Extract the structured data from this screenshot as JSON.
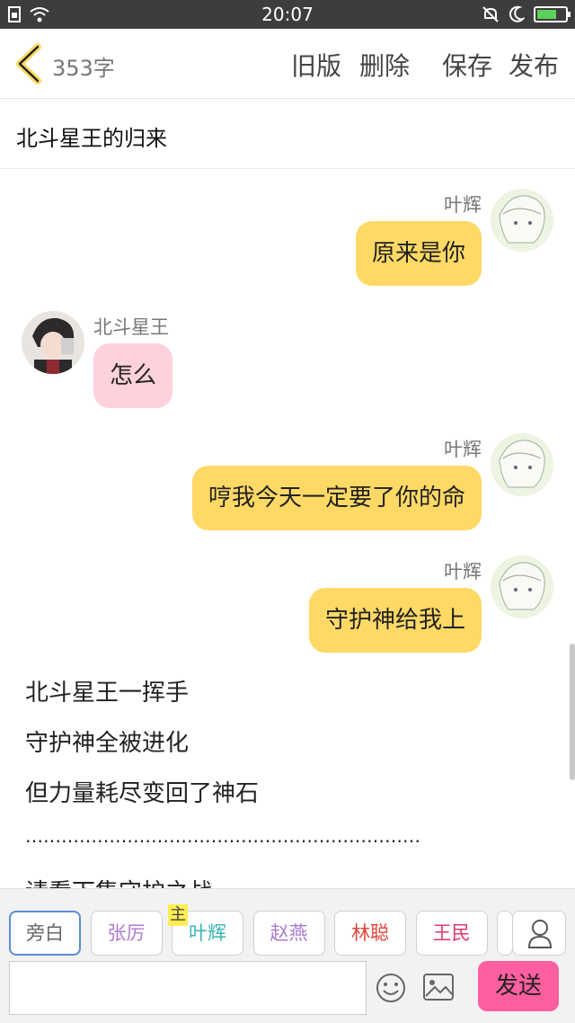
{
  "status_bar": {
    "time": "20:07",
    "battery_level": 0.7
  },
  "topbar": {
    "word_count": "353字",
    "actions": [
      "旧版",
      "删除",
      "保存",
      "发布"
    ]
  },
  "story": {
    "title": "北斗星王的归来"
  },
  "messages": [
    {
      "speaker": "叶辉",
      "text": "原来是你",
      "side": "right",
      "color": "#ffd966"
    },
    {
      "speaker": "北斗星王",
      "text": "怎么",
      "side": "left",
      "color": "#ffd1dc"
    },
    {
      "speaker": "叶辉",
      "text": "哼我今天一定要了你的命",
      "side": "right",
      "color": "#ffd966"
    },
    {
      "speaker": "叶辉",
      "text": "守护神给我上",
      "side": "right",
      "color": "#ffd966"
    }
  ],
  "narration": [
    "北斗星王一挥手",
    "守护神全被进化",
    "但力量耗尽变回了神石",
    "…………………………………………………………",
    "请看下集守护之战"
  ],
  "characters": [
    {
      "label": "旁白",
      "color": "#666666",
      "active": true
    },
    {
      "label": "张厉",
      "color": "#b07acc"
    },
    {
      "label": "叶辉",
      "color": "#3ab3b3",
      "tag": "主"
    },
    {
      "label": "赵燕",
      "color": "#a87ad0"
    },
    {
      "label": "林聪",
      "color": "#e0453a"
    },
    {
      "label": "王民",
      "color": "#e03a6a"
    }
  ],
  "input": {
    "placeholder": ""
  },
  "send_label": "发送",
  "icons": [
    "back-icon",
    "wifi-icon",
    "sim-icon",
    "mute-icon",
    "moon-icon",
    "battery-icon",
    "person-icon",
    "emoji-icon",
    "image-icon"
  ]
}
